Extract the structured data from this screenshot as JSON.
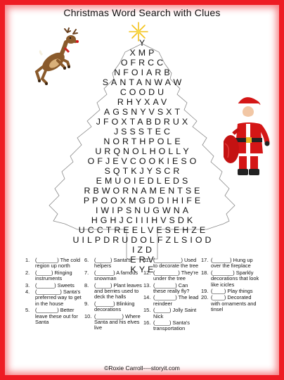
{
  "title": "Christmas Word Search with Clues",
  "grid_rows": [
    "Y",
    "XMP",
    "OFRCC",
    "NFOIARB",
    "SANTANWAW",
    "COODU",
    "RHYXAV",
    "AGSNYVSXT",
    "JFOXTABDRUX",
    "JSSSTEC",
    "NORTHPOLE",
    "URQNOLHOLLY",
    "OFJEVCOOKIESO",
    "SQTKJYSCR",
    "EMUOIEDLEDS",
    "RBWORNAMENTSE",
    "PPOOXMGDDIHIFE",
    "IWIPSNUGWNA",
    "HGHJCIIIHVSDK",
    "UCCTREELVESEHZE",
    "UILPDRUDOLFZLSIOD",
    "IZD",
    "ERV",
    "KYE"
  ],
  "clues": [
    [
      {
        "n": "1.",
        "t": "(_______) The cold region up north"
      },
      {
        "n": "2.",
        "t": "(_____) Ringing instruments"
      },
      {
        "n": "3.",
        "t": "(______) Sweets"
      },
      {
        "n": "4.",
        "t": "(________) Santa's preferred way to get in the house"
      },
      {
        "n": "5.",
        "t": "(_______) Better leave these out for Santa"
      }
    ],
    [
      {
        "n": "6.",
        "t": "(_____) Santa's helpers"
      },
      {
        "n": "7.",
        "t": "(______) A famous snowman"
      },
      {
        "n": "8.",
        "t": "(_____) Plant leaves and berries used to deck the halls"
      },
      {
        "n": "9.",
        "t": "(______) Blinking decorations"
      },
      {
        "n": "10.",
        "t": "(_________) Where Santa and his elves live"
      }
    ],
    [
      {
        "n": "11.",
        "t": "(_________) Used to decorate the tree"
      },
      {
        "n": "12.",
        "t": "(________) They're under the tree"
      },
      {
        "n": "13.",
        "t": "(_______) Can these really fly?"
      },
      {
        "n": "14.",
        "t": "(_______) The lead reindeer"
      },
      {
        "n": "15.",
        "t": "(_____) Jolly Saint Nick"
      },
      {
        "n": "16.",
        "t": "(_____) Santa's transportation"
      }
    ],
    [
      {
        "n": "17.",
        "t": "(______) Hung up over the fireplace"
      },
      {
        "n": "18.",
        "t": "(_______) Sparkly decorations that look like icicles"
      },
      {
        "n": "19.",
        "t": "(____) Play things"
      },
      {
        "n": "20.",
        "t": "(____) Decorated with ornaments and tinsel"
      }
    ]
  ],
  "copyright": "©Roxie Carroll----storyit.com",
  "colors": {
    "border": "#ee1c24",
    "star": "#f3c21a",
    "santa_red": "#d41616",
    "reindeer_brown": "#8a5a2b"
  },
  "images": [
    "reindeer",
    "santa-claus",
    "star"
  ]
}
